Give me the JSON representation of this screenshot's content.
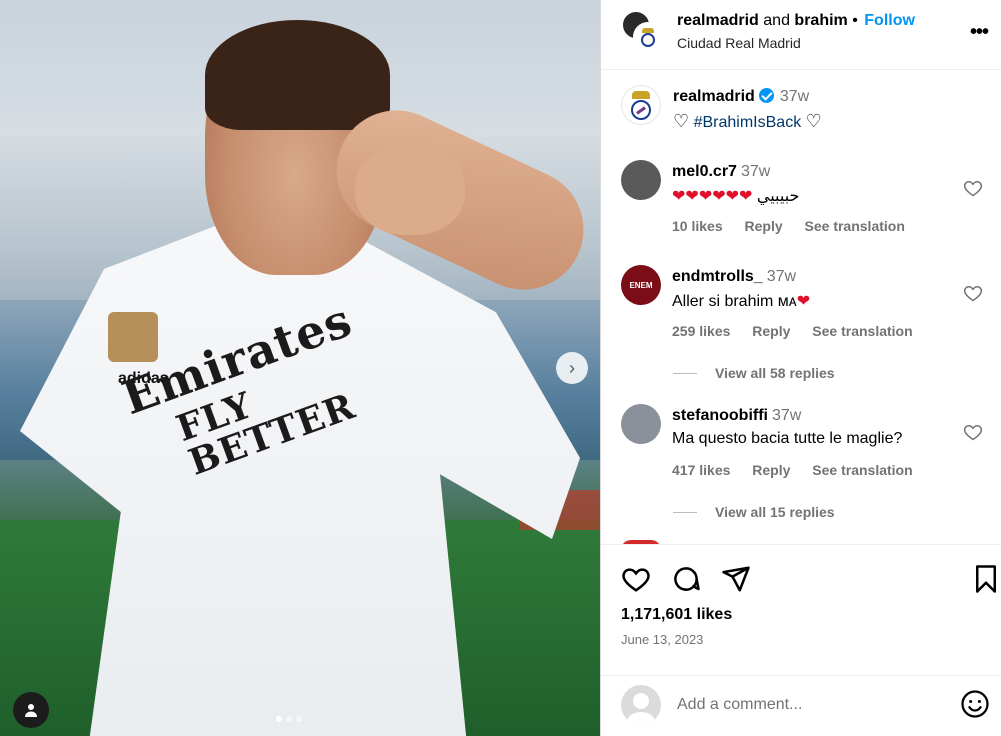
{
  "media": {
    "sponsor_line1": "Emirates",
    "sponsor_line2": "FLY BETTER",
    "brand_text": "adidas",
    "carousel_next": "›",
    "dot_count": 3
  },
  "header": {
    "primary_user": "realmadrid",
    "joiner": "and",
    "secondary_user": "brahim",
    "separator": "•",
    "follow_label": "Follow",
    "location": "Ciudad Real Madrid",
    "more_label": "•••"
  },
  "caption": {
    "user": "realmadrid",
    "time": "37w",
    "text_prefix": "♡",
    "hashtag": "#BrahimIsBack",
    "text_suffix": "♡"
  },
  "comments": [
    {
      "user": "mel0.cr7",
      "time": "37w",
      "hearts": "❤❤❤❤❤❤",
      "text": "حبيبيي",
      "likes": "10 likes",
      "reply": "Reply",
      "translate": "See translation",
      "avatar_color": "#5a5a5a"
    },
    {
      "user": "endmtrolls_",
      "time": "37w",
      "text": "Aller si brahim ᴍᴀ",
      "hearts": "❤",
      "likes": "259 likes",
      "reply": "Reply",
      "translate": "See translation",
      "avatar_color": "#7a0d16",
      "avatar_text": "ENEM",
      "view_replies": "View all 58 replies"
    },
    {
      "user": "stefanoobiffi",
      "time": "37w",
      "text": "Ma questo bacia tutte le maglie?",
      "likes": "417 likes",
      "reply": "Reply",
      "translate": "See translation",
      "avatar_color": "#8a9099",
      "view_replies": "View all 15 replies"
    }
  ],
  "actions": {
    "likes": "1,171,601 likes",
    "date": "June 13, 2023"
  },
  "composer": {
    "placeholder": "Add a comment..."
  },
  "colors": {
    "accent": "#0095f6",
    "heart": "#e0102a",
    "muted": "#737373"
  }
}
